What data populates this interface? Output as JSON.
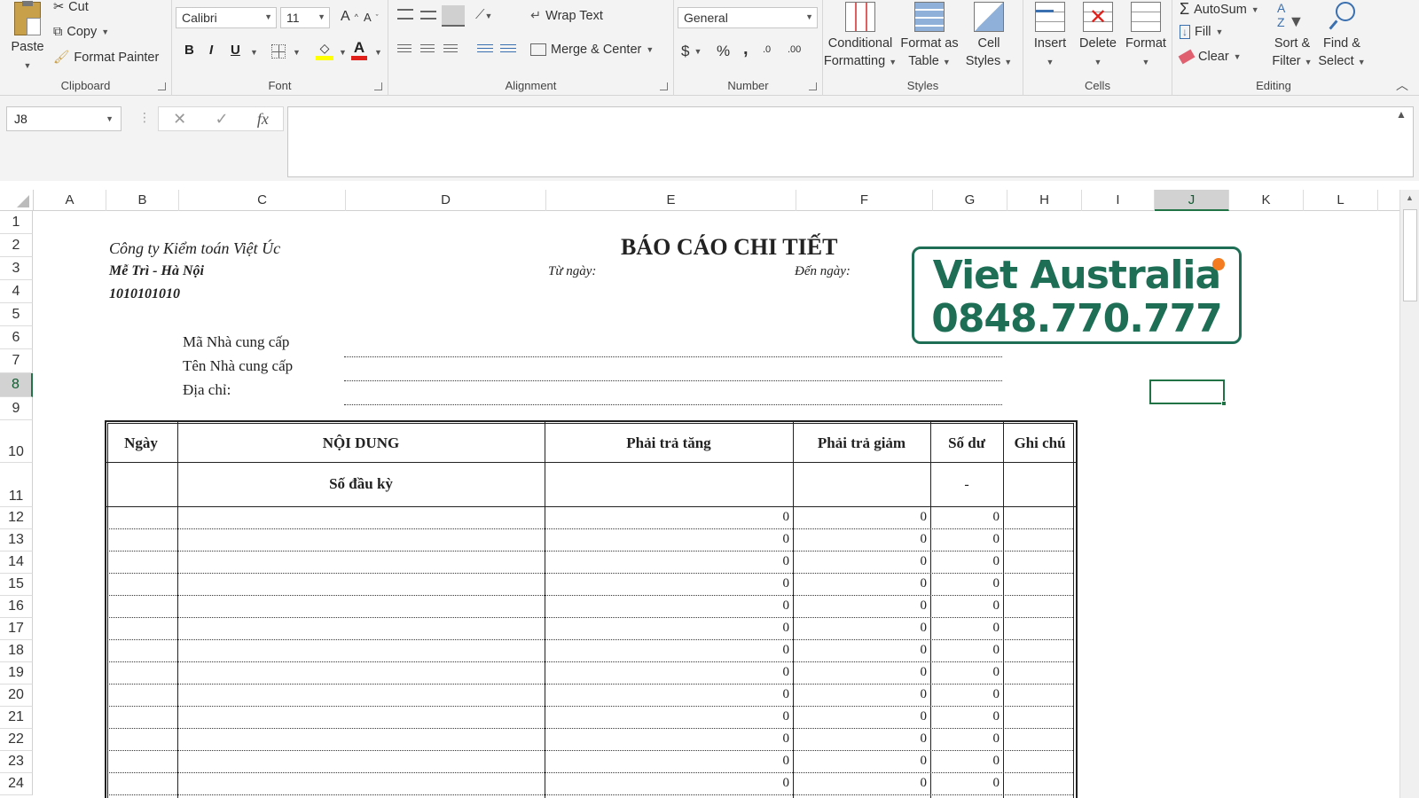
{
  "ribbon": {
    "clipboard": {
      "group": "Clipboard",
      "paste": "Paste",
      "cut": "Cut",
      "copy": "Copy",
      "format_painter": "Format Painter"
    },
    "font": {
      "group": "Font",
      "font_name": "Calibri",
      "font_size": "11",
      "bold": "B",
      "italic": "I",
      "underline": "U",
      "grow": "A",
      "shrink": "A"
    },
    "alignment": {
      "group": "Alignment",
      "wrap_text": "Wrap Text",
      "merge_center": "Merge & Center"
    },
    "number": {
      "group": "Number",
      "format": "General",
      "currency": "$",
      "percent": "%",
      "comma": ",",
      "inc_dec": ".0",
      "dec_dec": ".00"
    },
    "styles": {
      "group": "Styles",
      "conditional_1": "Conditional",
      "conditional_2": "Formatting",
      "format_table_1": "Format as",
      "format_table_2": "Table",
      "cell_styles_1": "Cell",
      "cell_styles_2": "Styles"
    },
    "cells": {
      "group": "Cells",
      "insert": "Insert",
      "delete": "Delete",
      "format": "Format"
    },
    "editing": {
      "group": "Editing",
      "autosum": "AutoSum",
      "fill": "Fill",
      "clear": "Clear",
      "sort_1": "Sort &",
      "sort_2": "Filter",
      "find_1": "Find &",
      "find_2": "Select"
    }
  },
  "formula_bar": {
    "name_box": "J8",
    "cancel": "✕",
    "enter": "✓",
    "fx": "fx",
    "formula": ""
  },
  "columns": [
    "A",
    "B",
    "C",
    "D",
    "E",
    "F",
    "G",
    "H",
    "I",
    "J",
    "K",
    "L"
  ],
  "selected_column": "J",
  "rows": [
    "1",
    "2",
    "3",
    "4",
    "5",
    "6",
    "7",
    "8",
    "9",
    "10",
    "11",
    "12",
    "13",
    "14",
    "15",
    "16",
    "17",
    "18",
    "19",
    "20",
    "21",
    "22",
    "23",
    "24"
  ],
  "selected_row": "8",
  "sheet": {
    "company": "Công ty Kiểm toán Việt Úc",
    "address": "Mễ Trì - Hà Nội",
    "tax_code": "1010101010",
    "title": "BÁO CÁO CHI TIẾT",
    "from_date": "Từ ngày:",
    "to_date": "Đến ngày:",
    "supplier_code": "Mã Nhà cung cấp",
    "supplier_name": "Tên Nhà cung cấp",
    "supplier_address": "Địa chỉ:",
    "logo_line1": "Viet Australia",
    "logo_line2": "0848.770.777",
    "headers": {
      "date": "Ngày",
      "content": "NỘI DUNG",
      "increase": "Phải trả tăng",
      "decrease": "Phải trả giảm",
      "balance": "Số dư",
      "note": "Ghi chú"
    },
    "opening_label": "Số đầu kỳ",
    "opening_balance": "-",
    "data_rows": [
      {
        "row": "12",
        "increase": "0",
        "decrease": "0",
        "balance": "0"
      },
      {
        "row": "13",
        "increase": "0",
        "decrease": "0",
        "balance": "0"
      },
      {
        "row": "14",
        "increase": "0",
        "decrease": "0",
        "balance": "0"
      },
      {
        "row": "15",
        "increase": "0",
        "decrease": "0",
        "balance": "0"
      },
      {
        "row": "16",
        "increase": "0",
        "decrease": "0",
        "balance": "0"
      },
      {
        "row": "17",
        "increase": "0",
        "decrease": "0",
        "balance": "0"
      },
      {
        "row": "18",
        "increase": "0",
        "decrease": "0",
        "balance": "0"
      },
      {
        "row": "19",
        "increase": "0",
        "decrease": "0",
        "balance": "0"
      },
      {
        "row": "20",
        "increase": "0",
        "decrease": "0",
        "balance": "0"
      },
      {
        "row": "21",
        "increase": "0",
        "decrease": "0",
        "balance": "0"
      },
      {
        "row": "22",
        "increase": "0",
        "decrease": "0",
        "balance": "0"
      },
      {
        "row": "23",
        "increase": "0",
        "decrease": "0",
        "balance": "0"
      },
      {
        "row": "24",
        "increase": "0",
        "decrease": "0",
        "balance": "0"
      }
    ]
  },
  "colors": {
    "excel_green": "#217346",
    "logo_green": "#1d6e55",
    "logo_dot": "#f47b20",
    "font_red": "#e0201b",
    "highlight_yellow": "#ffff00"
  }
}
